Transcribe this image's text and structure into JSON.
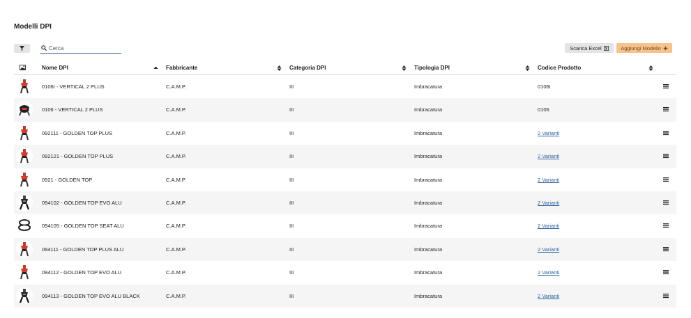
{
  "page": {
    "title": "Modelli DPI"
  },
  "toolbar": {
    "search_placeholder": "Cerca",
    "excel_label": "Scarica Excel",
    "add_label": "Aggiungi Modello"
  },
  "colors": {
    "accent": "#f4c48c",
    "link": "#2a5fa0",
    "stripe": "#f5f5f5"
  },
  "table": {
    "columns": [
      "Nome DPI",
      "Fabbricante",
      "Categoria DPI",
      "Tipologia DPI",
      "Codice Prodotto"
    ],
    "rows": [
      {
        "name": "0106I - VERTICAL 2 PLUS",
        "manufacturer": "C.A.M.P.",
        "category": "III",
        "type": "Imbracatura",
        "code": "0106I",
        "code_link": false,
        "thumb": "harness-red"
      },
      {
        "name": "0106 - VERTICAL 2 PLUS",
        "manufacturer": "C.A.M.P.",
        "category": "III",
        "type": "Imbracatura",
        "code": "0106",
        "code_link": false,
        "thumb": "harness-black-red"
      },
      {
        "name": "092111 - GOLDEN TOP PLUS",
        "manufacturer": "C.A.M.P.",
        "category": "III",
        "type": "Imbracatura",
        "code": "2 Varianti",
        "code_link": true,
        "thumb": "harness-red"
      },
      {
        "name": "092121 - GOLDEN TOP PLUS",
        "manufacturer": "C.A.M.P.",
        "category": "III",
        "type": "Imbracatura",
        "code": "2 Varianti",
        "code_link": true,
        "thumb": "harness-red"
      },
      {
        "name": "0921 - GOLDEN TOP",
        "manufacturer": "C.A.M.P.",
        "category": "III",
        "type": "Imbracatura",
        "code": "2 Varianti",
        "code_link": true,
        "thumb": "harness-red"
      },
      {
        "name": "094102 - GOLDEN TOP EVO ALU",
        "manufacturer": "C.A.M.P.",
        "category": "III",
        "type": "Imbracatura",
        "code": "2 Varianti",
        "code_link": true,
        "thumb": "harness-black"
      },
      {
        "name": "094105 - GOLDEN TOP SEAT ALU",
        "manufacturer": "C.A.M.P.",
        "category": "III",
        "type": "Imbracatura",
        "code": "2 Varianti",
        "code_link": true,
        "thumb": "harness-seat"
      },
      {
        "name": "094111 - GOLDEN TOP PLUS ALU",
        "manufacturer": "C.A.M.P.",
        "category": "III",
        "type": "Imbracatura",
        "code": "2 Varianti",
        "code_link": true,
        "thumb": "harness-red"
      },
      {
        "name": "094112 - GOLDEN TOP EVO ALU",
        "manufacturer": "C.A.M.P.",
        "category": "III",
        "type": "Imbracatura",
        "code": "2 Varianti",
        "code_link": true,
        "thumb": "harness-red"
      },
      {
        "name": "094113 - GOLDEN TOP EVO ALU BLACK",
        "manufacturer": "C.A.M.P.",
        "category": "III",
        "type": "Imbracatura",
        "code": "2 Varianti",
        "code_link": true,
        "thumb": "harness-black"
      }
    ]
  }
}
